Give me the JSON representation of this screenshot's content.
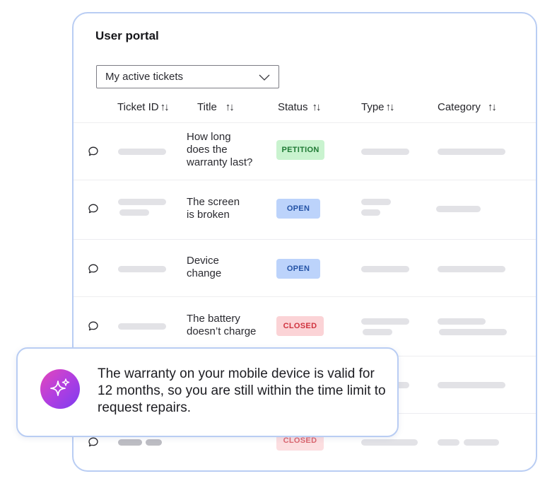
{
  "portal": {
    "title": "User portal",
    "filter": {
      "selected": "My active tickets"
    },
    "columns": [
      {
        "label": "Ticket ID",
        "sort": "↑↓"
      },
      {
        "label": "Title",
        "sort": "↑↓"
      },
      {
        "label": "Status",
        "sort": "↑↓"
      },
      {
        "label": "Type",
        "sort": "↑↓"
      },
      {
        "label": "Category",
        "sort": "↑↓"
      }
    ],
    "rows": [
      {
        "title": "How long\ndoes the\nwarranty last?",
        "status": "PETITION"
      },
      {
        "title": "The screen\nis broken",
        "status": "OPEN"
      },
      {
        "title": "Device\nchange",
        "status": "OPEN"
      },
      {
        "title": "The battery\ndoesn’t charge",
        "status": "CLOSED"
      },
      {
        "title": "",
        "status": ""
      },
      {
        "title": "",
        "status": "CLOSED"
      }
    ]
  },
  "assistant": {
    "icon": "sparkle-icon",
    "message": "The warranty on your mobile device is valid for 12 months, so you are still within the time limit to request repairs."
  },
  "colors": {
    "border": "#b9cdf3",
    "petition_bg": "#c9f3cf",
    "petition_fg": "#1f7a34",
    "open_bg": "#bcd3fb",
    "open_fg": "#2453a6",
    "closed_bg": "#fbd3d6",
    "closed_fg": "#d0333f"
  }
}
